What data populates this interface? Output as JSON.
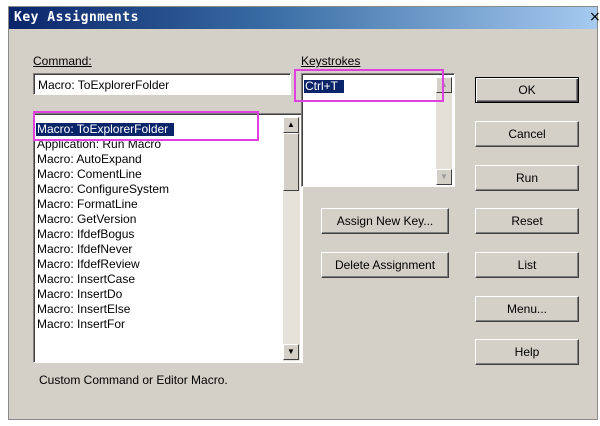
{
  "dialog": {
    "title": "Key Assignments",
    "close_glyph": "×"
  },
  "command": {
    "label": "Command:",
    "value": "Macro: ToExplorerFolder"
  },
  "command_list": {
    "items": [
      "Macro: ToExplorerFolder",
      "Application: Run Macro",
      "Macro: AutoExpand",
      "Macro: ComentLine",
      "Macro: ConfigureSystem",
      "Macro: FormatLine",
      "Macro: GetVersion",
      "Macro: IfdefBogus",
      "Macro: IfdefNever",
      "Macro: IfdefReview",
      "Macro: InsertCase",
      "Macro: InsertDo",
      "Macro: InsertElse",
      "Macro: InsertFor"
    ],
    "selected_index": 0
  },
  "keystrokes": {
    "label": "Keystrokes",
    "items": [
      "Ctrl+T"
    ]
  },
  "buttons": {
    "ok": "OK",
    "cancel": "Cancel",
    "run": "Run",
    "reset": "Reset",
    "list": "List",
    "menu": "Menu...",
    "help": "Help",
    "assign_new_key": "Assign New Key...",
    "delete_assignment": "Delete Assignment"
  },
  "status_text": "Custom Command or Editor Macro.",
  "colors": {
    "highlight_box": "#e040e0",
    "selection": "#0a246a",
    "dialog_bg": "#d4d0c8"
  },
  "icons": {
    "scroll_up": "up-arrow-icon",
    "scroll_down": "down-arrow-icon"
  }
}
